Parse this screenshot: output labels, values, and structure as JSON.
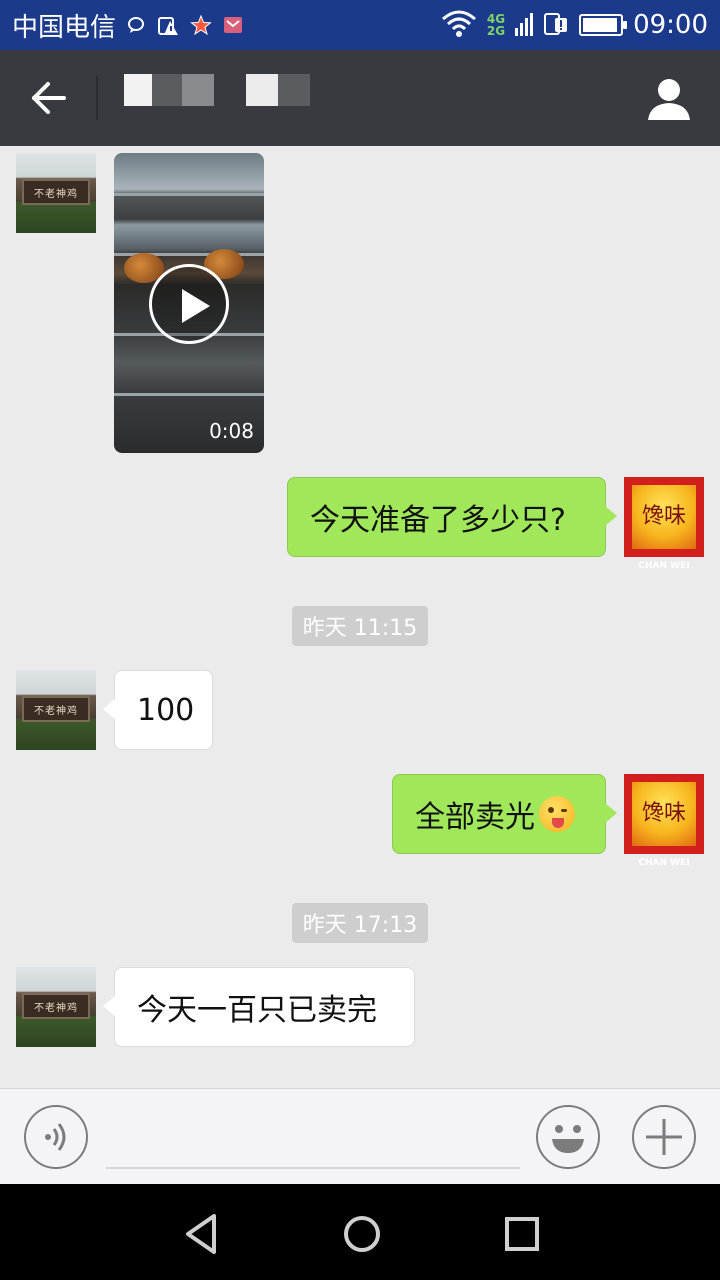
{
  "status_bar": {
    "carrier": "中国电信",
    "network_top": "4G",
    "network_bottom": "2G",
    "time": "09:00"
  },
  "header": {
    "back_icon": "arrow-left-icon",
    "profile_icon": "person-icon"
  },
  "messages": [
    {
      "type": "video",
      "side": "left",
      "duration": "0:08"
    },
    {
      "type": "text",
      "side": "right",
      "text": "今天准备了多少只?"
    },
    {
      "type": "timestamp",
      "text": "昨天 11:15"
    },
    {
      "type": "text",
      "side": "left",
      "text": "100"
    },
    {
      "type": "text",
      "side": "right",
      "text": "全部卖光",
      "emoji": "tongue-wink-emoji"
    },
    {
      "type": "timestamp",
      "text": "昨天 17:13"
    },
    {
      "type": "text",
      "side": "left",
      "text": "今天一百只已卖完"
    }
  ],
  "avatars": {
    "contact_sign_text": "不老神鸡",
    "self_glyph": "馋味",
    "self_brand": "CHAN WEI"
  },
  "input_bar": {
    "voice_icon": "voice-icon",
    "emoji_icon": "emoji-icon",
    "plus_icon": "plus-icon"
  },
  "colors": {
    "status_bar": "#1b3a8c",
    "title_bar": "#393a3f",
    "chat_bg": "#ebebeb",
    "bubble_green": "#a0e75a",
    "bubble_white": "#ffffff"
  }
}
